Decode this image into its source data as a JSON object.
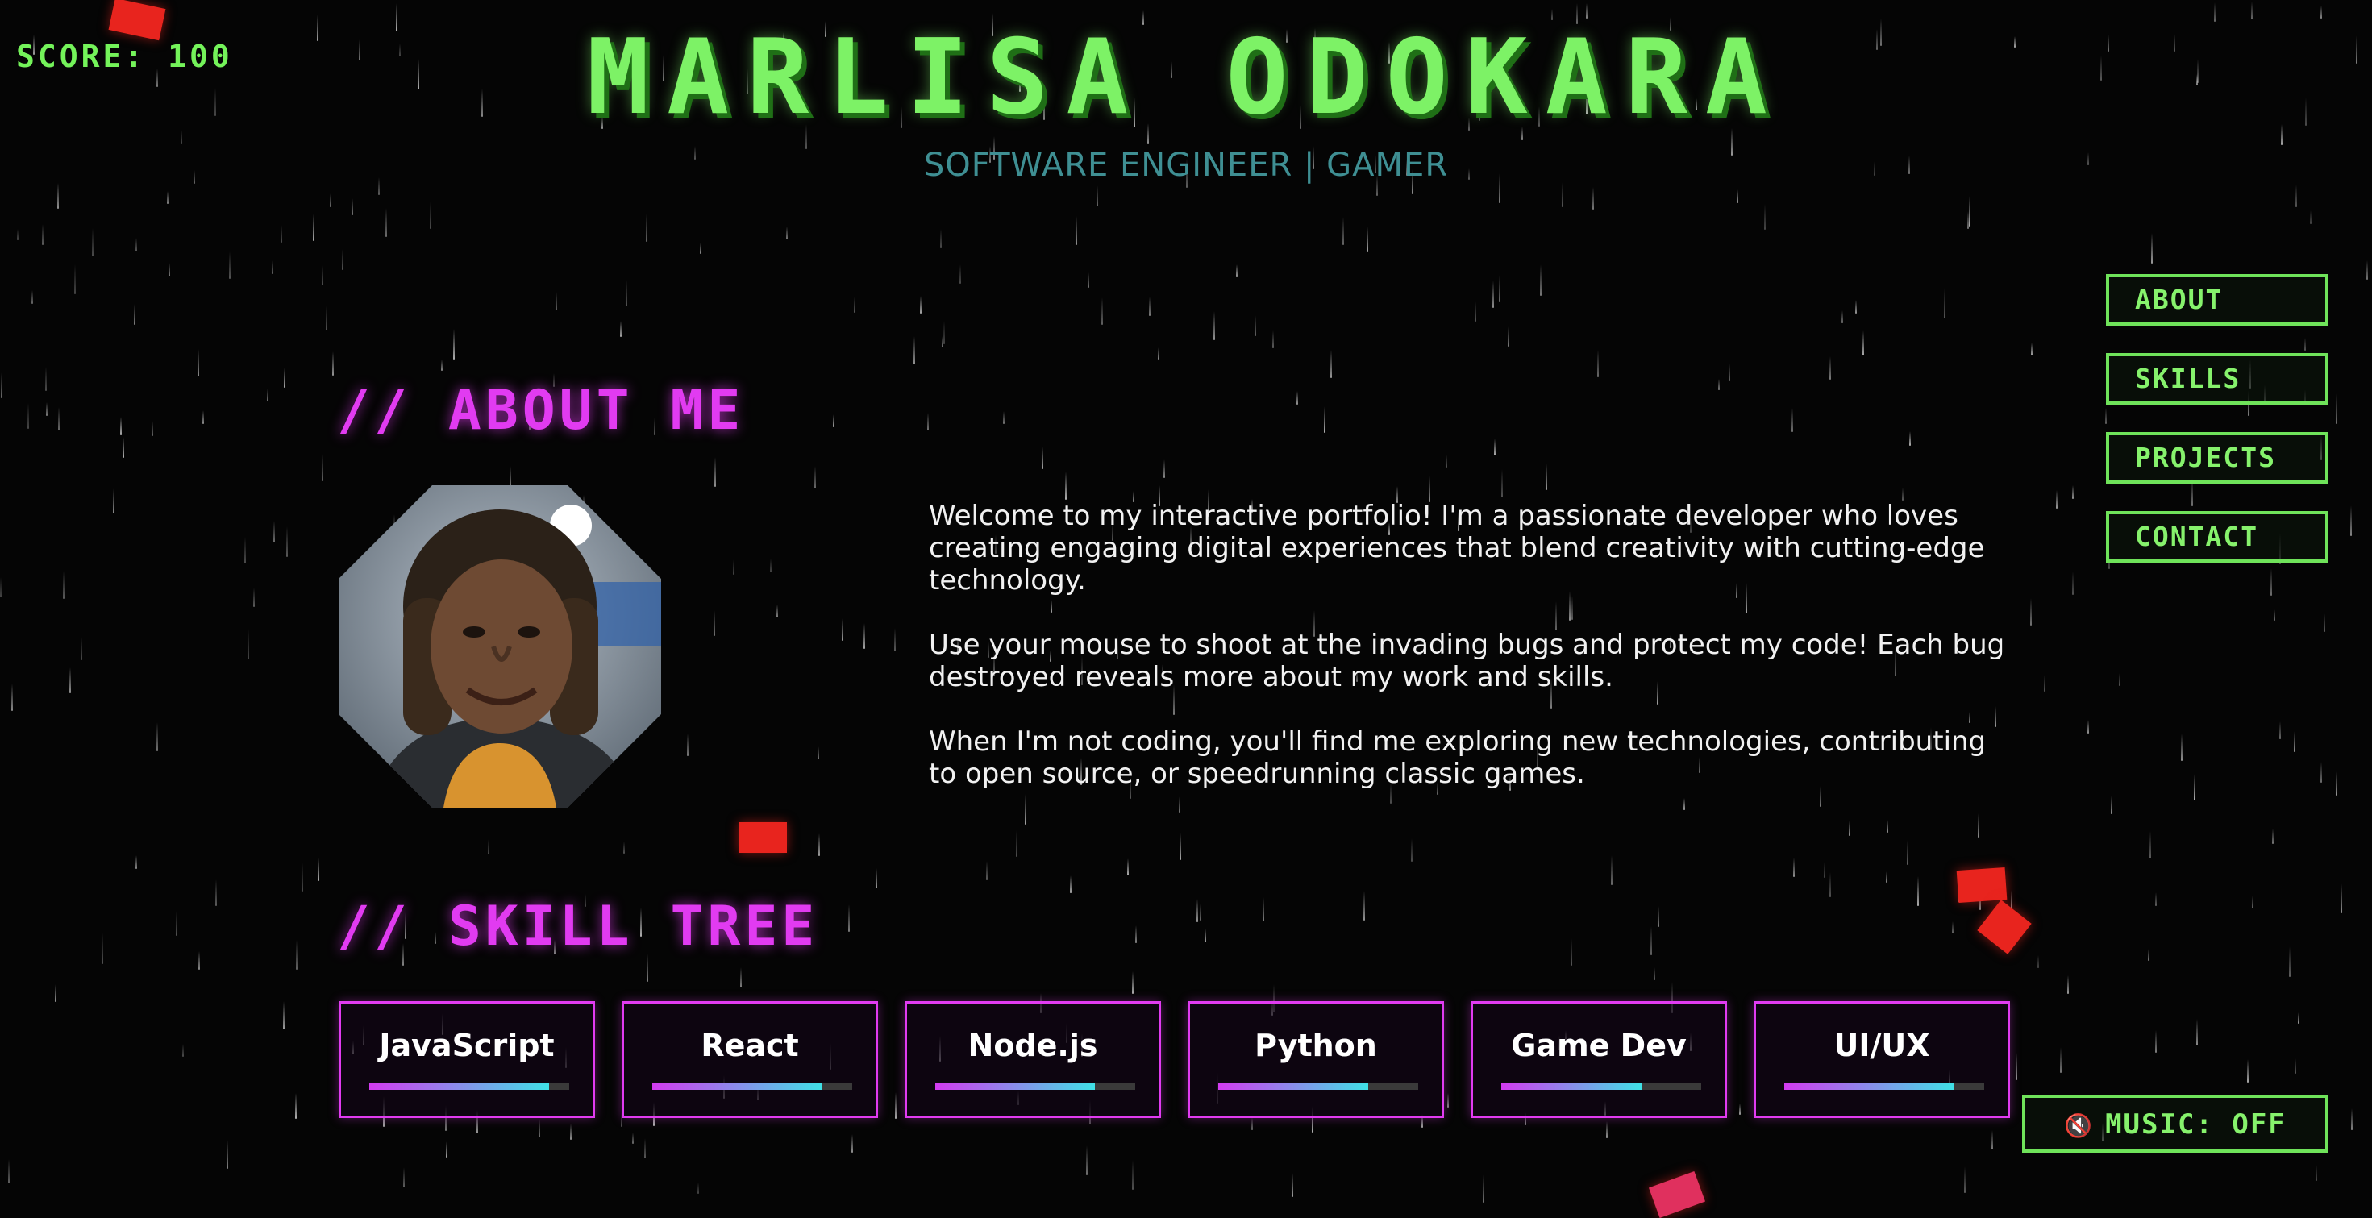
{
  "score": {
    "label": "SCORE: 100"
  },
  "hero": {
    "title": "MARLISA ODOKARA",
    "subtitle": "SOFTWARE ENGINEER | GAMER"
  },
  "nav": {
    "items": [
      {
        "label": "ABOUT"
      },
      {
        "label": "SKILLS"
      },
      {
        "label": "PROJECTS"
      },
      {
        "label": "CONTACT"
      }
    ]
  },
  "about": {
    "title": "// ABOUT ME",
    "paragraphs": [
      "Welcome to my interactive portfolio! I'm a passionate developer who loves creating engaging digital experiences that blend creativity with cutting-edge technology.",
      "Use your mouse to shoot at the invading bugs and protect my code! Each bug destroyed reveals more about my work and skills.",
      "When I'm not coding, you'll find me exploring new technologies, contributing to open source, or speedrunning classic games."
    ]
  },
  "skills": {
    "title": "// SKILL TREE",
    "items": [
      {
        "name": "JavaScript",
        "level": 0.9
      },
      {
        "name": "React",
        "level": 0.85
      },
      {
        "name": "Node.js",
        "level": 0.8
      },
      {
        "name": "Python",
        "level": 0.75
      },
      {
        "name": "Game Dev",
        "level": 0.7
      },
      {
        "name": "UI/UX",
        "level": 0.85
      }
    ]
  },
  "music": {
    "label": "MUSIC: OFF",
    "icon": "muted-speaker-icon"
  },
  "colors": {
    "neon_green": "#7df266",
    "neon_magenta": "#e13bf1",
    "teal": "#3f8f93",
    "bug_red": "#e8241e",
    "background": "#050505"
  }
}
